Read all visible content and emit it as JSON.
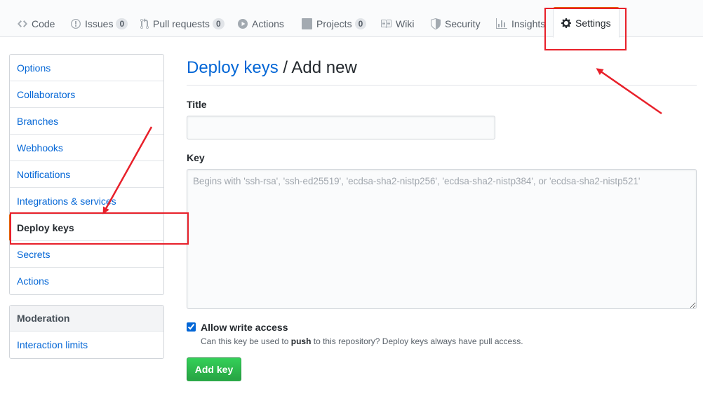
{
  "tabs": [
    {
      "key": "code",
      "label": "Code",
      "icon": "code-icon"
    },
    {
      "key": "issues",
      "label": "Issues",
      "count": "0",
      "icon": "issue-opened-icon"
    },
    {
      "key": "pulls",
      "label": "Pull requests",
      "count": "0",
      "icon": "git-pull-request-icon"
    },
    {
      "key": "actions",
      "label": "Actions",
      "icon": "play-icon"
    },
    {
      "key": "projects",
      "label": "Projects",
      "count": "0",
      "icon": "project-icon"
    },
    {
      "key": "wiki",
      "label": "Wiki",
      "icon": "book-icon"
    },
    {
      "key": "security",
      "label": "Security",
      "icon": "shield-icon"
    },
    {
      "key": "insights",
      "label": "Insights",
      "icon": "graph-icon"
    },
    {
      "key": "settings",
      "label": "Settings",
      "icon": "gear-icon",
      "selected": true
    }
  ],
  "sidebar": {
    "items": [
      {
        "label": "Options"
      },
      {
        "label": "Collaborators"
      },
      {
        "label": "Branches"
      },
      {
        "label": "Webhooks"
      },
      {
        "label": "Notifications"
      },
      {
        "label": "Integrations & services"
      },
      {
        "label": "Deploy keys",
        "selected": true
      },
      {
        "label": "Secrets"
      },
      {
        "label": "Actions"
      }
    ],
    "moderation": {
      "heading": "Moderation",
      "items": [
        {
          "label": "Interaction limits"
        }
      ]
    }
  },
  "main": {
    "breadcrumb_link": "Deploy keys",
    "breadcrumb_sep": " / ",
    "breadcrumb_current": "Add new",
    "title_label": "Title",
    "title_value": "",
    "key_label": "Key",
    "key_placeholder": "Begins with 'ssh-rsa', 'ssh-ed25519', 'ecdsa-sha2-nistp256', 'ecdsa-sha2-nistp384', or 'ecdsa-sha2-nistp521'",
    "allow_write_label": "Allow write access",
    "allow_write_checked": true,
    "note_before": "Can this key be used to ",
    "note_bold": "push",
    "note_after": " to this repository? Deploy keys always have pull access.",
    "submit_label": "Add key"
  },
  "colors": {
    "link": "#0366d6",
    "selected_accent": "#e36209",
    "button_green": "#28a745",
    "annotation_red": "#e8202a"
  }
}
